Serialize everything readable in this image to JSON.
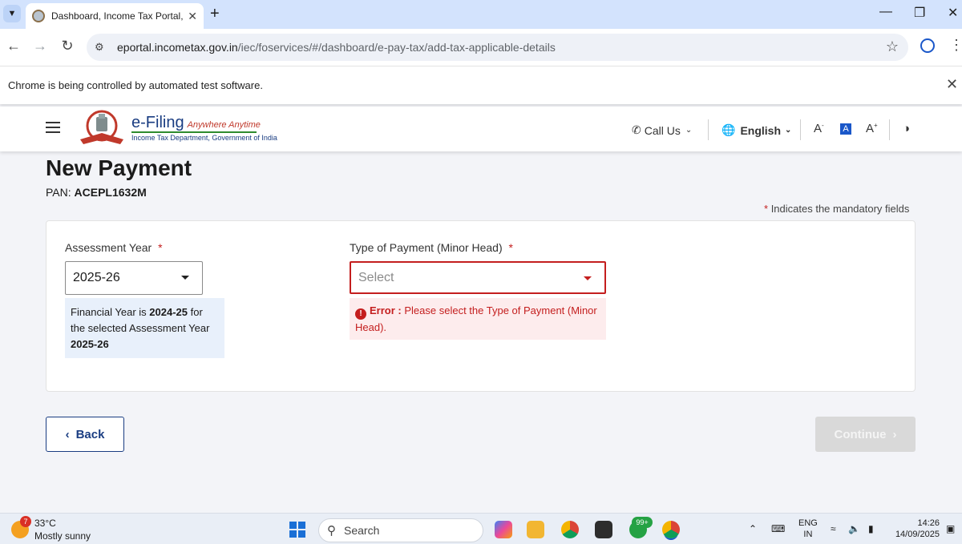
{
  "browser": {
    "tab_title": "Dashboard, Income Tax Portal, G",
    "url_host": "eportal.incometax.gov.in",
    "url_path": "/iec/foservices/#/dashboard/e-pay-tax/add-tax-applicable-details",
    "infobar_text": "Chrome is being controlled by automated test software."
  },
  "site": {
    "logo_main": "e-Filing",
    "logo_tagline": "Anywhere Anytime",
    "logo_sub": "Income Tax Department, Government of India",
    "call_us": "Call Us",
    "language": "English",
    "font_decrease": "A",
    "font_normal": "A",
    "font_increase": "A"
  },
  "page": {
    "title": "New Payment",
    "pan_label": "PAN:",
    "pan_value": "ACEPL1632M",
    "mandatory_note": "Indicates the mandatory fields",
    "assessment_year_label": "Assessment Year",
    "assessment_year_value": "2025-26",
    "fy_info_1": "Financial Year is ",
    "fy_info_fy": "2024-25",
    "fy_info_2": " for the selected Assessment Year ",
    "fy_info_ay": "2025-26",
    "payment_type_label": "Type of Payment (Minor Head)",
    "payment_type_placeholder": "Select",
    "error_label": "Error",
    "error_message": "Please select the Type of Payment (Minor Head).",
    "back_label": "Back",
    "continue_label": "Continue"
  },
  "taskbar": {
    "weather_badge": "7",
    "temperature": "33°C",
    "weather": "Mostly sunny",
    "search_label": "Search",
    "whatsapp_badge": "99+",
    "lang_1": "ENG",
    "lang_2": "IN",
    "time": "14:26",
    "date": "14/09/2025"
  },
  "colors": {
    "brand_blue": "#1a3d82",
    "error_red": "#c41e1e",
    "info_bg": "#e8f0fb"
  }
}
